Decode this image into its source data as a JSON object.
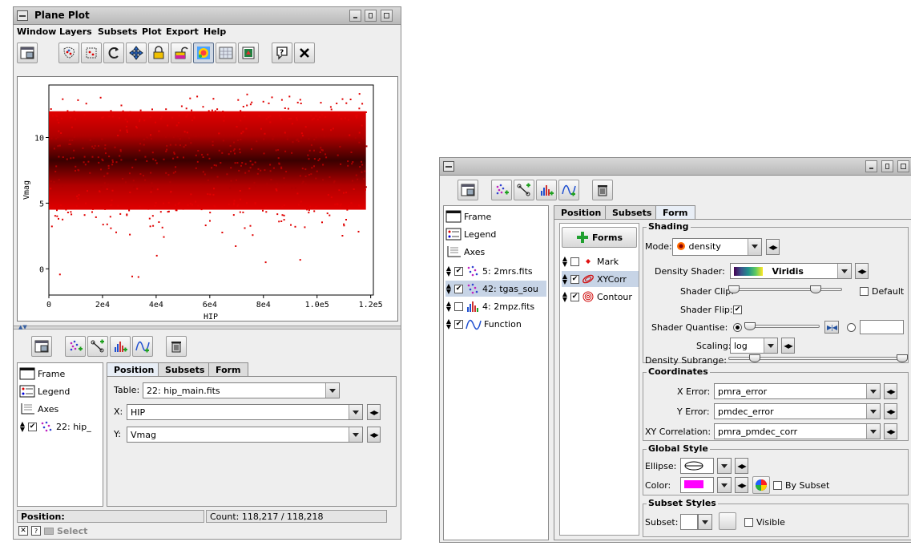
{
  "left_window": {
    "title": "Plane Plot",
    "menu": [
      "Window",
      "Layers",
      "Subsets",
      "Plot",
      "Export",
      "Help"
    ],
    "toolbar_icons": [
      "window-icon",
      "select-points-icon",
      "select-region-icon",
      "replot-icon",
      "navigate-icon",
      "lock-icon",
      "unlock-icon",
      "rainbow-icon",
      "grid-icon",
      "export-icon",
      "help-icon",
      "close-icon"
    ],
    "plot": {
      "y_axis_label": "Vmag",
      "x_axis_label": "HIP"
    },
    "layer_controls": [
      "window-icon",
      "add-scatter-icon",
      "add-pair-icon",
      "add-histogram-icon",
      "add-function-icon",
      "delete-icon"
    ],
    "layers": [
      {
        "label": "Frame"
      },
      {
        "label": "Legend"
      },
      {
        "label": "Axes"
      },
      {
        "label": "22: hip_"
      }
    ],
    "tabs": [
      "Position",
      "Subsets",
      "Form"
    ],
    "table_label": "Table:",
    "table_value": "22: hip_main.fits",
    "x_label": "X:",
    "x_value": "HIP",
    "y_label": "Y:",
    "y_value": "Vmag",
    "status_position": "Position:",
    "status_count": "Count: 118,217 / 118,218",
    "select_label": "Select"
  },
  "right_window": {
    "toolbar_icons": [
      "window-icon",
      "add-scatter-icon",
      "add-pair-icon",
      "add-histogram-icon",
      "add-function-icon",
      "delete-icon"
    ],
    "layers": [
      {
        "label": "Frame"
      },
      {
        "label": "Legend"
      },
      {
        "label": "Axes"
      },
      {
        "label": "5: 2mrs.fits"
      },
      {
        "label": "42: tgas_sou"
      },
      {
        "label": "4: 2mpz.fits"
      },
      {
        "label": "Function"
      }
    ],
    "tabs": [
      "Position",
      "Subsets",
      "Form"
    ],
    "forms_button": "Forms",
    "forms": [
      {
        "label": "Mark",
        "checked": false
      },
      {
        "label": "XYCorr",
        "checked": true
      },
      {
        "label": "Contour",
        "checked": true
      }
    ],
    "shading": {
      "title": "Shading",
      "mode_label": "Mode:",
      "mode_value": "density",
      "shader_label": "Density Shader:",
      "shader_value": "Viridis",
      "clip_label": "Shader Clip:",
      "default_label": "Default",
      "flip_label": "Shader Flip:",
      "quantise_label": "Shader Quantise:",
      "scaling_label": "Scaling:",
      "scaling_value": "log",
      "subrange_label": "Density Subrange:"
    },
    "coordinates": {
      "title": "Coordinates",
      "x_error_label": "X Error:",
      "x_error_value": "pmra_error",
      "y_error_label": "Y Error:",
      "y_error_value": "pmdec_error",
      "xy_corr_label": "XY Correlation:",
      "xy_corr_value": "pmra_pmdec_corr"
    },
    "global_style": {
      "title": "Global Style",
      "ellipse_label": "Ellipse:",
      "color_label": "Color:",
      "color_value": "#ff00ff",
      "by_subset_label": "By Subset"
    },
    "subset_styles": {
      "title": "Subset Styles",
      "subset_label": "Subset:",
      "visible_label": "Visible"
    }
  },
  "chart_data": {
    "type": "scatter",
    "title": "",
    "xlabel": "HIP",
    "ylabel": "Vmag",
    "xlim": [
      0,
      121000
    ],
    "ylim": [
      -2,
      14
    ],
    "x_ticks": [
      {
        "value": 0,
        "label": "0"
      },
      {
        "value": 20000,
        "label": "2e4"
      },
      {
        "value": 40000,
        "label": "4e4"
      },
      {
        "value": 60000,
        "label": "6e4"
      },
      {
        "value": 80000,
        "label": "8e4"
      },
      {
        "value": 100000,
        "label": "1.0e5"
      },
      {
        "value": 120000,
        "label": "1.2e5"
      }
    ],
    "y_ticks": [
      {
        "value": 0,
        "label": "0"
      },
      {
        "value": 5,
        "label": "5"
      },
      {
        "value": 10,
        "label": "10"
      }
    ],
    "density_band": {
      "x_range": [
        0,
        118218
      ],
      "core_vmag": [
        6.5,
        9.5
      ],
      "dense_vmag": [
        4.5,
        12
      ],
      "sparse_vmag": [
        -1,
        13.5
      ]
    },
    "count": 118217,
    "colors": {
      "dense": "#3a0000",
      "mid": "#b00000",
      "sparse": "#e00000"
    },
    "grid": false,
    "legend": "none"
  }
}
